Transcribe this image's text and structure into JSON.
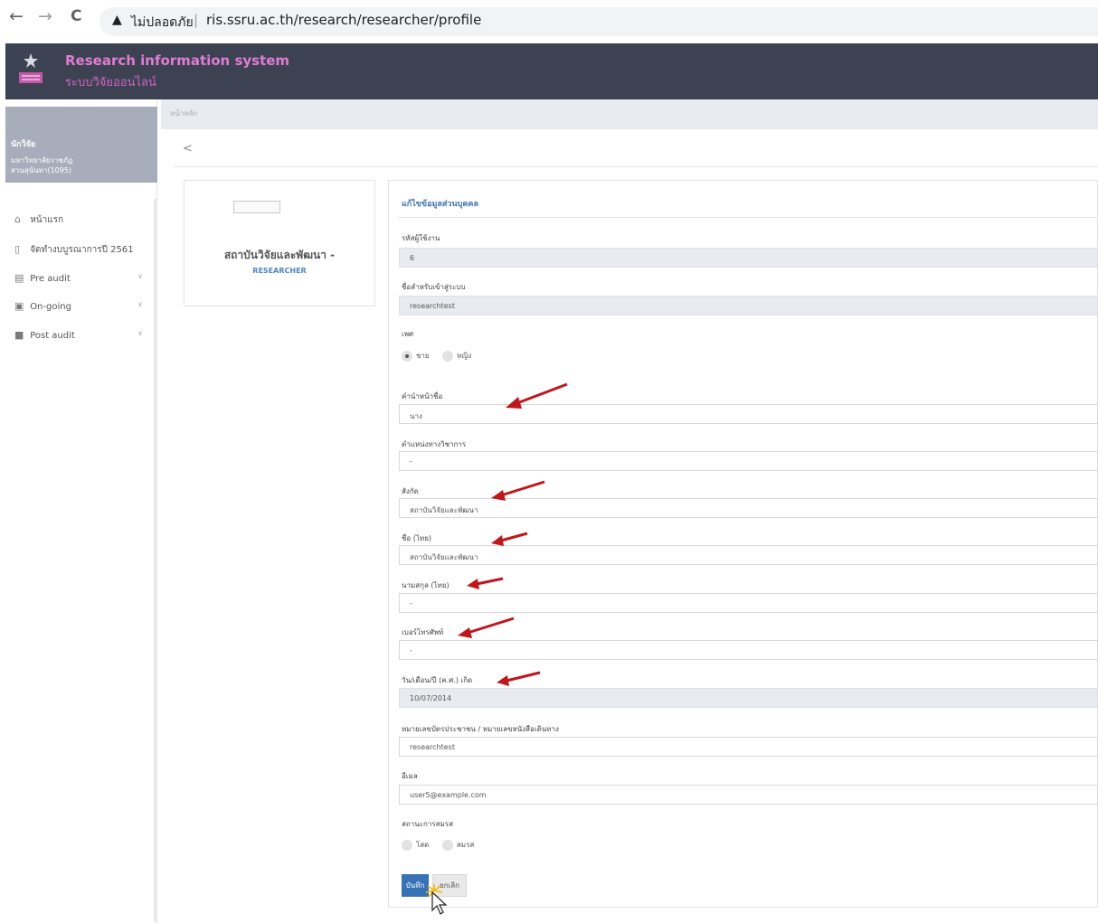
{
  "browser": {
    "back_glyph": "←",
    "forward_glyph": "→",
    "reload_glyph": "C",
    "security_text": "ไม่ปลอดภัย",
    "separator": "|",
    "url": "ris.ssru.ac.th/research/researcher/profile"
  },
  "header": {
    "title": "Research information system",
    "subtitle": "ระบบวิจัยออนไลน์"
  },
  "sidebar": {
    "user_role": "นักวิจัย",
    "user_org": "มหาวิทยาลัยราชภัฏสวนสุนันทา(1095)",
    "items": [
      {
        "label": "หน้าแรก",
        "icon": "home-icon"
      },
      {
        "label": "จัดทำงบบูรณาการปี 2561",
        "icon": "bookmark-icon"
      },
      {
        "label": "Pre audit",
        "icon": "document-icon"
      },
      {
        "label": "On-going",
        "icon": "play-square-icon"
      },
      {
        "label": "Post audit",
        "icon": "file-icon"
      }
    ],
    "chevron": "∨"
  },
  "breadcrumb": "หน้าหลัก",
  "share_glyph": "<",
  "profile": {
    "name": "สถาบันวิจัยและพัฒนา -",
    "role": "RESEARCHER"
  },
  "form": {
    "title": "แก้ไขข้อมูลส่วนบุคคล",
    "fields": {
      "user_id": {
        "label": "รหัสผู้ใช้งาน",
        "value": "6"
      },
      "username": {
        "label": "ชื่อสำหรับเข้าสู่ระบบ",
        "value": "researchtest"
      },
      "gender": {
        "label": "เพศ",
        "options": [
          "ชาย",
          "หญิง"
        ],
        "selected": "ชาย"
      },
      "prefix": {
        "label": "คำนำหน้าชื่อ",
        "value": "นาง"
      },
      "academic_position": {
        "label": "ตำแหน่งทางวิชาการ",
        "value": "-"
      },
      "affiliation": {
        "label": "สังกัด",
        "value": "สถาบันวิจัยและพัฒนา"
      },
      "first_name_th": {
        "label": "ชื่อ (ไทย)",
        "value": "สถาบันวิจัยและพัฒนา"
      },
      "last_name_th": {
        "label": "นามสกุล (ไทย)",
        "value": "-"
      },
      "phone": {
        "label": "เบอร์โทรศัพท์",
        "value": "-"
      },
      "birth_date": {
        "label": "วัน/เดือน/ปี (ค.ศ.) เกิด",
        "value": "10/07/2014"
      },
      "id_card": {
        "label": "หมายเลขบัตรประชาชน / หมายเลขหนังสือเดินทาง",
        "value": "researchtest"
      },
      "email": {
        "label": "อีเมล",
        "value": "user5@example.com"
      },
      "marital_status": {
        "label": "สถานะการสมรส",
        "options": [
          "โสด",
          "สมรส"
        ],
        "selected": ""
      }
    },
    "save_label": "บันทึก",
    "cancel_label": "ยกเลิก"
  },
  "colors": {
    "header_bg": "#3c4252",
    "title_pink": "#e07cd2",
    "sidebar_user_bg": "#a7adbb",
    "primary_blue": "#3872b6",
    "annotation_arrow": "#c0171c"
  }
}
